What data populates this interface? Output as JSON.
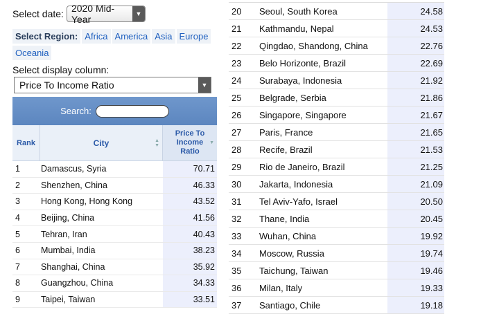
{
  "date_filter": {
    "label": "Select date:",
    "value": "2020 Mid-Year"
  },
  "region_filter": {
    "label": "Select Region:",
    "options": [
      "Africa",
      "America",
      "Asia",
      "Europe",
      "Oceania"
    ]
  },
  "display_column": {
    "label": "Select display column:",
    "value": "Price To Income Ratio"
  },
  "search": {
    "label": "Search:",
    "value": ""
  },
  "table": {
    "headers": {
      "rank": "Rank",
      "city": "City",
      "value": "Price To Income Ratio"
    },
    "rows": [
      {
        "rank": "1",
        "city": "Damascus, Syria",
        "value": "70.71"
      },
      {
        "rank": "2",
        "city": "Shenzhen, China",
        "value": "46.33"
      },
      {
        "rank": "3",
        "city": "Hong Kong, Hong Kong",
        "value": "43.52"
      },
      {
        "rank": "4",
        "city": "Beijing, China",
        "value": "41.56"
      },
      {
        "rank": "5",
        "city": "Tehran, Iran",
        "value": "40.43"
      },
      {
        "rank": "6",
        "city": "Mumbai, India",
        "value": "38.23"
      },
      {
        "rank": "7",
        "city": "Shanghai, China",
        "value": "35.92"
      },
      {
        "rank": "8",
        "city": "Guangzhou, China",
        "value": "34.33"
      },
      {
        "rank": "9",
        "city": "Taipei, Taiwan",
        "value": "33.51"
      }
    ],
    "rows_right": [
      {
        "rank": "20",
        "city": "Seoul, South Korea",
        "value": "24.58"
      },
      {
        "rank": "21",
        "city": "Kathmandu, Nepal",
        "value": "24.53"
      },
      {
        "rank": "22",
        "city": "Qingdao, Shandong, China",
        "value": "22.76"
      },
      {
        "rank": "23",
        "city": "Belo Horizonte, Brazil",
        "value": "22.69"
      },
      {
        "rank": "24",
        "city": "Surabaya, Indonesia",
        "value": "21.92"
      },
      {
        "rank": "25",
        "city": "Belgrade, Serbia",
        "value": "21.86"
      },
      {
        "rank": "26",
        "city": "Singapore, Singapore",
        "value": "21.67"
      },
      {
        "rank": "27",
        "city": "Paris, France",
        "value": "21.65"
      },
      {
        "rank": "28",
        "city": "Recife, Brazil",
        "value": "21.53"
      },
      {
        "rank": "29",
        "city": "Rio de Janeiro, Brazil",
        "value": "21.25"
      },
      {
        "rank": "30",
        "city": "Jakarta, Indonesia",
        "value": "21.09"
      },
      {
        "rank": "31",
        "city": "Tel Aviv-Yafo, Israel",
        "value": "20.50"
      },
      {
        "rank": "32",
        "city": "Thane, India",
        "value": "20.45"
      },
      {
        "rank": "33",
        "city": "Wuhan, China",
        "value": "19.92"
      },
      {
        "rank": "34",
        "city": "Moscow, Russia",
        "value": "19.74"
      },
      {
        "rank": "35",
        "city": "Taichung, Taiwan",
        "value": "19.46"
      },
      {
        "rank": "36",
        "city": "Milan, Italy",
        "value": "19.33"
      },
      {
        "rank": "37",
        "city": "Santiago, Chile",
        "value": "19.18"
      }
    ]
  },
  "colors": {
    "header_blue": "#5c86bf",
    "link_blue": "#1e5fbf",
    "value_col_bg": "#eceffc"
  }
}
